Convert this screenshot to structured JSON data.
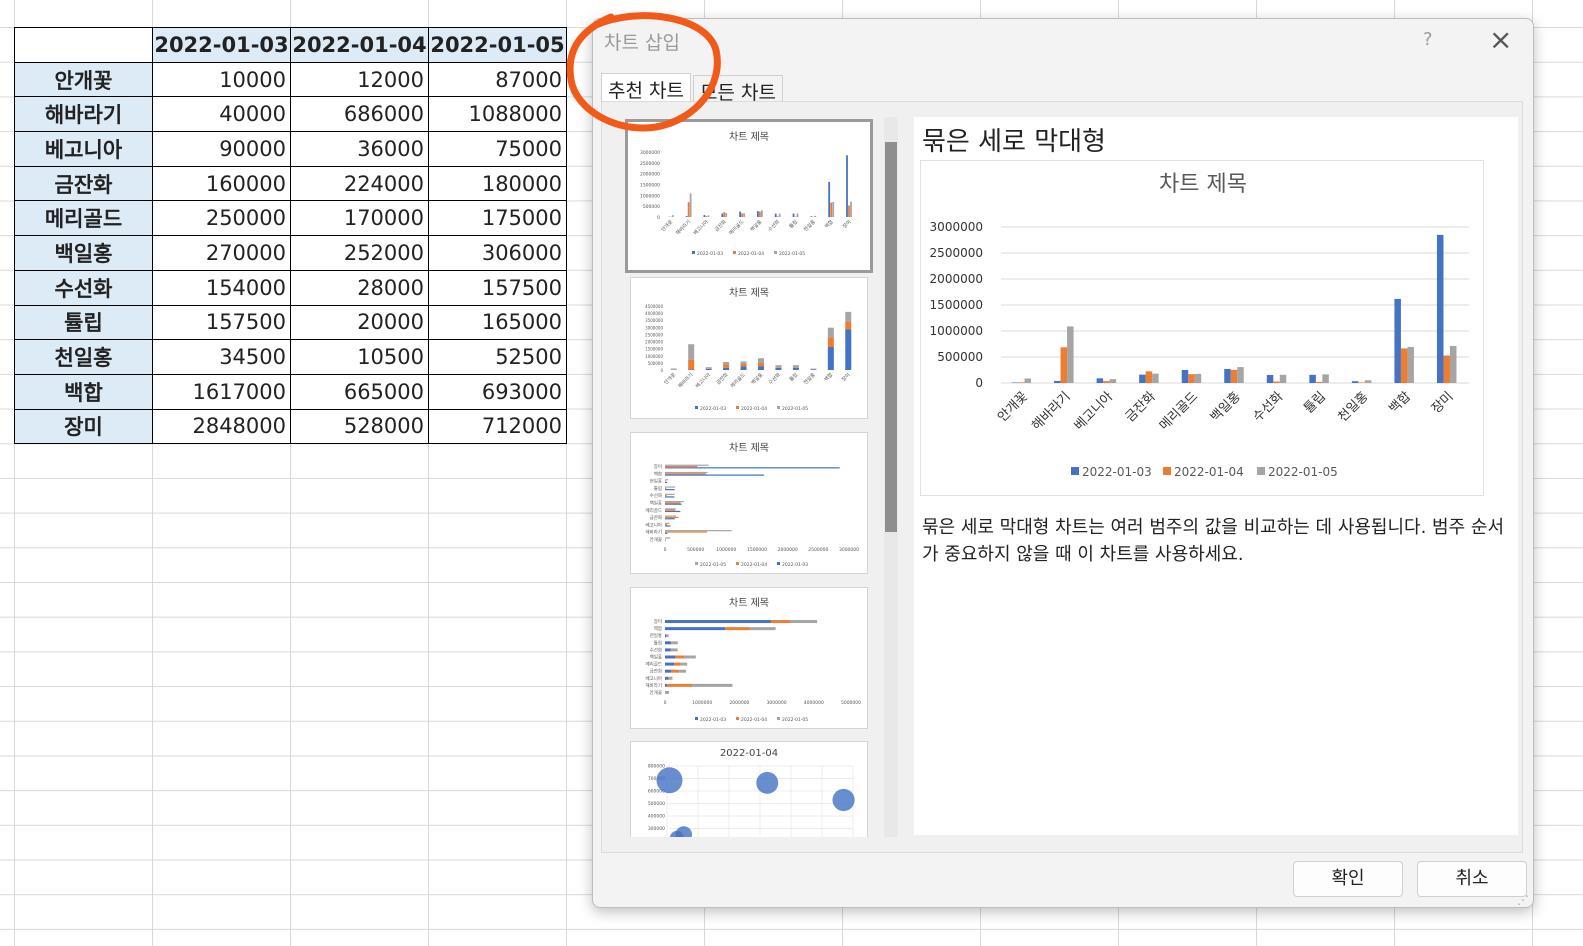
{
  "spreadsheet": {
    "columns": [
      "2022-01-03",
      "2022-01-04",
      "2022-01-05"
    ],
    "rows": [
      {
        "label": "안개꽃",
        "values": [
          "10000",
          "12000",
          "87000"
        ]
      },
      {
        "label": "해바라기",
        "values": [
          "40000",
          "686000",
          "1088000"
        ]
      },
      {
        "label": "베고니아",
        "values": [
          "90000",
          "36000",
          "75000"
        ]
      },
      {
        "label": "금잔화",
        "values": [
          "160000",
          "224000",
          "180000"
        ]
      },
      {
        "label": "메리골드",
        "values": [
          "250000",
          "170000",
          "175000"
        ]
      },
      {
        "label": "백일홍",
        "values": [
          "270000",
          "252000",
          "306000"
        ]
      },
      {
        "label": "수선화",
        "values": [
          "154000",
          "28000",
          "157500"
        ]
      },
      {
        "label": "튤립",
        "values": [
          "157500",
          "20000",
          "165000"
        ]
      },
      {
        "label": "천일홍",
        "values": [
          "34500",
          "10500",
          "52500"
        ]
      },
      {
        "label": "백합",
        "values": [
          "1617000",
          "665000",
          "693000"
        ]
      },
      {
        "label": "장미",
        "values": [
          "2848000",
          "528000",
          "712000"
        ]
      }
    ]
  },
  "dialog": {
    "title": "차트 삽입",
    "help_label": "?",
    "close_label": "×",
    "tabs": {
      "recommended": "추천 차트",
      "all": "모든 차트"
    },
    "thumbnails": {
      "t1": "차트 제목",
      "t2": "차트 제목",
      "t3": "차트 제목",
      "t4": "차트 제목",
      "t5": "2022-01-04"
    },
    "preview": {
      "title": "묶은 세로 막대형",
      "description": "묶은 세로 막대형 차트는 여러 범주의 값을 비교하는 데 사용됩니다. 범주 순서가 중요하지 않을 때 이 차트를 사용하세요."
    },
    "buttons": {
      "ok": "확인",
      "cancel": "취소"
    }
  },
  "colors": {
    "series1": "#4472c4",
    "series2": "#ed7d31",
    "series3": "#a5a5a5",
    "header_fill": "#ddebf7",
    "annotation": "#f25a1a"
  },
  "chart_data": {
    "type": "bar",
    "title": "차트 제목",
    "categories": [
      "안개꽃",
      "해바라기",
      "베고니아",
      "금잔화",
      "메리골드",
      "백일홍",
      "수선화",
      "튤립",
      "천일홍",
      "백합",
      "장미"
    ],
    "series": [
      {
        "name": "2022-01-03",
        "values": [
          10000,
          40000,
          90000,
          160000,
          250000,
          270000,
          154000,
          157500,
          34500,
          1617000,
          2848000
        ]
      },
      {
        "name": "2022-01-04",
        "values": [
          12000,
          686000,
          36000,
          224000,
          170000,
          252000,
          28000,
          20000,
          10500,
          665000,
          528000
        ]
      },
      {
        "name": "2022-01-05",
        "values": [
          87000,
          1088000,
          75000,
          180000,
          175000,
          306000,
          157500,
          165000,
          52500,
          693000,
          712000
        ]
      }
    ],
    "ylim": [
      0,
      3000000
    ],
    "yticks": [
      "0",
      "500000",
      "1000000",
      "1500000",
      "2000000",
      "2500000",
      "3000000"
    ],
    "grid": true,
    "legend": "bottom"
  }
}
